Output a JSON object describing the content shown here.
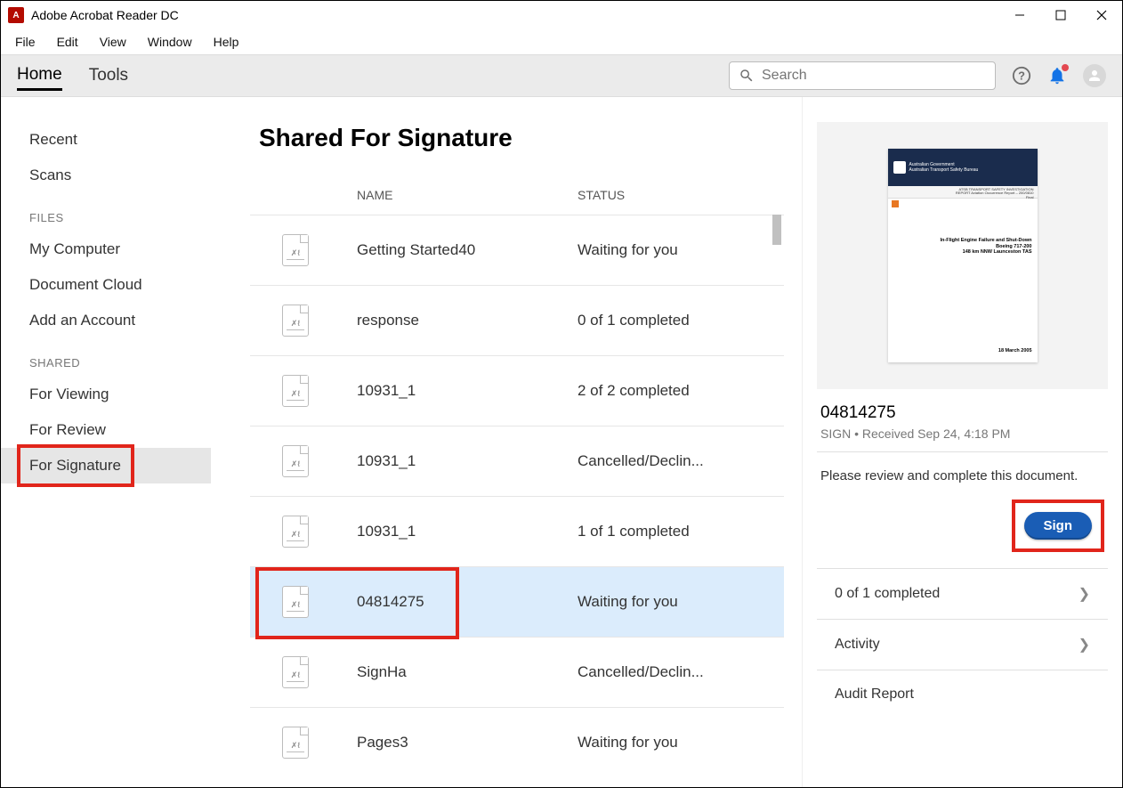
{
  "app_title": "Adobe Acrobat Reader DC",
  "menu": [
    "File",
    "Edit",
    "View",
    "Window",
    "Help"
  ],
  "topnav": {
    "home": "Home",
    "tools": "Tools"
  },
  "search_placeholder": "Search",
  "sidebar": {
    "items_top": [
      "Recent",
      "Scans"
    ],
    "files_header": "FILES",
    "files_items": [
      "My Computer",
      "Document Cloud",
      "Add an Account"
    ],
    "shared_header": "SHARED",
    "shared_items": [
      "For Viewing",
      "For Review",
      "For Signature"
    ]
  },
  "page_title": "Shared For Signature",
  "columns": {
    "name": "NAME",
    "status": "STATUS"
  },
  "rows": [
    {
      "name": "Getting Started40",
      "status": "Waiting for you"
    },
    {
      "name": "response",
      "status": "0 of 1 completed"
    },
    {
      "name": "10931_1",
      "status": "2 of 2 completed"
    },
    {
      "name": "10931_1",
      "status": "Cancelled/Declin..."
    },
    {
      "name": "10931_1",
      "status": "1 of 1 completed"
    },
    {
      "name": "04814275",
      "status": "Waiting for you"
    },
    {
      "name": "SignHa",
      "status": "Cancelled/Declin..."
    },
    {
      "name": "Pages3",
      "status": "Waiting for you"
    }
  ],
  "details": {
    "title": "04814275",
    "meta": "SIGN  •  Received Sep 24, 4:18 PM",
    "desc": "Please review and complete this document.",
    "sign_label": "Sign",
    "status": "0 of 1 completed",
    "activity": "Activity",
    "audit": "Audit Report"
  },
  "preview": {
    "gov1": "Australian Government",
    "gov2": "Australian Transport Safety Bureau",
    "sub1": "ATSB TRANSPORT SAFETY INVESTIGATION",
    "sub2": "REPORT Aviation Occurrence Report – 200/0810",
    "sub3": "Final",
    "body1": "In-Flight Engine Failure and Shut-Down",
    "body2": "Boeing 717-200",
    "body3": "148 km NNW Launceston TAS",
    "date": "18 March 2005"
  }
}
